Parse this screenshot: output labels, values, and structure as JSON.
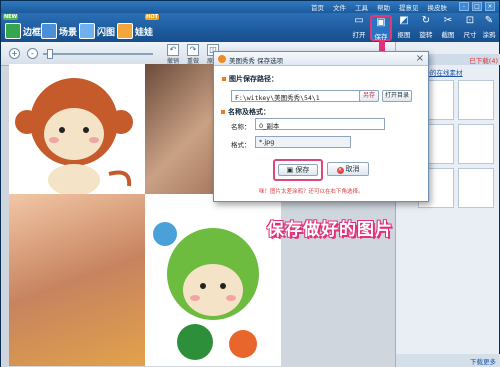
{
  "menubar": {
    "items": [
      "首页",
      "文件",
      "工具",
      "帮助",
      "提意见",
      "换皮肤"
    ],
    "window_buttons": [
      "-",
      "□",
      "×"
    ]
  },
  "mode_tabs": [
    {
      "label": "边框",
      "badge": "NEW",
      "icon": "frame-icon"
    },
    {
      "label": "场景",
      "icon": "scene-icon"
    },
    {
      "label": "闪图",
      "icon": "flash-icon"
    },
    {
      "label": "娃娃",
      "badge": "HOT",
      "icon": "doll-icon"
    }
  ],
  "toolbar": {
    "open_label": "打开",
    "save_label": "保存",
    "crop_label": "抠图",
    "rotate_label": "旋转",
    "screenshot_label": "截图",
    "size_label": "尺寸",
    "paint_label": "涂鸦"
  },
  "edit_toolbar": {
    "zoom_in": "+",
    "zoom_out": "-",
    "zoom_level": 0.05,
    "undo_label": "撤销",
    "redo_label": "重做",
    "reset_label": "原图"
  },
  "side_panel": {
    "tab_label": "已下载(4)",
    "link": "下载更多的在线素材",
    "footer": "下载更多"
  },
  "dialog": {
    "title": "美图秀秀  保存选项",
    "section_path": "图片保存路径：",
    "path_value": "F:\\witkey\\美图秀秀\\54\\1",
    "other_btn": "另存",
    "open_dir_btn": "打开目录",
    "section_name": "名称及格式：",
    "name_label": "名称：",
    "name_value": "0_副本",
    "format_label": "格式：",
    "format_value": "*.jpg",
    "ok_label": "保存",
    "cancel_label": "取消",
    "warning": "咪！图片太差涂鸦？还可以在右下角选择。"
  },
  "caption": "保存做好的图片",
  "colors": {
    "accent": "#e2307a",
    "toolbar": "#1b5a9b"
  }
}
